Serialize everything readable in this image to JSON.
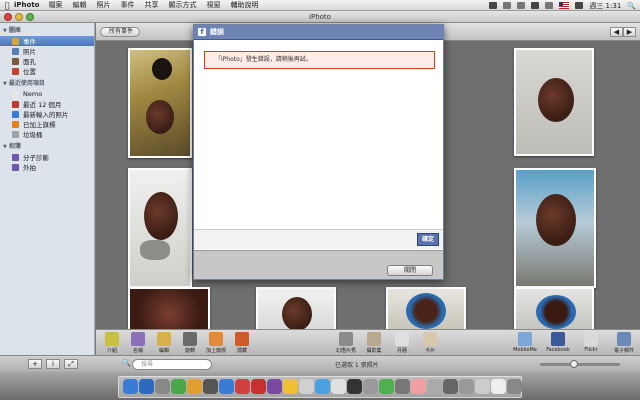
{
  "menubar": {
    "app_name": "iPhoto",
    "items": [
      "檔案",
      "編輯",
      "照片",
      "事件",
      "共享",
      "顯示方式",
      "視窗",
      "輔助說明"
    ],
    "clock": "週三 1:31"
  },
  "window": {
    "title": "iPhoto"
  },
  "sidebar": {
    "sections": [
      {
        "header": "圖庫",
        "items": [
          {
            "label": "事件",
            "icon": "events-icon",
            "color": "#d9a23b",
            "selected": true
          },
          {
            "label": "照片",
            "icon": "photos-icon",
            "color": "#5a7fb8"
          },
          {
            "label": "面孔",
            "icon": "faces-icon",
            "color": "#7a5a3a"
          },
          {
            "label": "位置",
            "icon": "places-icon",
            "color": "#c7412f"
          }
        ]
      },
      {
        "header": "最近使用項目",
        "items": [
          {
            "label": "Nemo",
            "icon": "event-icon",
            "color": "#e6e6e6"
          },
          {
            "label": "最近 12 個月",
            "icon": "calendar-icon",
            "color": "#c0392b"
          },
          {
            "label": "最新輸入的照片",
            "icon": "import-icon",
            "color": "#3a7bd5"
          },
          {
            "label": "已加上旗標",
            "icon": "flag-icon",
            "color": "#e67e22"
          },
          {
            "label": "垃圾桶",
            "icon": "trash-icon",
            "color": "#9aa2aa"
          }
        ]
      },
      {
        "header": "相簿",
        "items": [
          {
            "label": "分子診斷",
            "icon": "album-icon",
            "color": "#6b57b0"
          },
          {
            "label": "外拍",
            "icon": "album-icon",
            "color": "#6b57b0"
          }
        ]
      }
    ]
  },
  "topbar": {
    "back_label": "所有事件",
    "prev": "◀",
    "next": "▶"
  },
  "dialog": {
    "title": "錯誤",
    "logo": "f",
    "error_message": "「iPhoto」發生錯誤，請稍後再試。",
    "confirm_label": "確定",
    "close_label": "關閉"
  },
  "toolbar": {
    "left": [
      {
        "label": "介紹",
        "icon": "info-icon",
        "color": "#c8c040"
      },
      {
        "label": "名稱",
        "icon": "name-icon",
        "color": "#8a70b8"
      },
      {
        "label": "編輯",
        "icon": "pencil-icon",
        "color": "#d8b04a"
      },
      {
        "label": "旋轉",
        "icon": "rotate-icon",
        "color": "#6a6a6a"
      },
      {
        "label": "加上旗標",
        "icon": "flag-icon",
        "color": "#e08a3a"
      },
      {
        "label": "隱藏",
        "icon": "hide-icon",
        "color": "#d05a2a"
      }
    ],
    "middle": [
      {
        "label": "幻燈片秀",
        "icon": "play-icon",
        "color": "#8a8a8a"
      },
      {
        "label": "攝影集",
        "icon": "book-icon",
        "color": "#b8a890"
      },
      {
        "label": "月曆",
        "icon": "calendar-icon",
        "color": "#e0e0e0"
      },
      {
        "label": "卡片",
        "icon": "card-icon",
        "color": "#d8c8b0"
      }
    ],
    "right": [
      {
        "label": "MobileMe",
        "icon": "mobileme-icon",
        "color": "#7aa6d8"
      },
      {
        "label": "Facebook",
        "icon": "facebook-icon",
        "color": "#3b5998"
      },
      {
        "label": "Flickr",
        "icon": "flickr-icon",
        "color": "#dadada"
      },
      {
        "label": "電子郵件",
        "icon": "mail-icon",
        "color": "#6c8ab8"
      }
    ]
  },
  "statusbar": {
    "add": "+",
    "info": "i",
    "fullscreen": "⤢",
    "search_placeholder": "搜尋",
    "status": "已選取 1 張照片"
  },
  "dock": {
    "colors": [
      "#3a7bd5",
      "#2b6ac0",
      "#888888",
      "#4aa84a",
      "#e0a030",
      "#555555",
      "#3a7bd5",
      "#d04040",
      "#c83030",
      "#7a4aa0",
      "#f0c030",
      "#d0d0d0",
      "#4aa0e0",
      "#e0e0e0",
      "#333333",
      "#9a9a9a",
      "#50b050",
      "#777777",
      "#f0a0a0",
      "#aaaaaa",
      "#666666",
      "#999999",
      "#cccccc",
      "#eeeeee",
      "#888888"
    ]
  }
}
